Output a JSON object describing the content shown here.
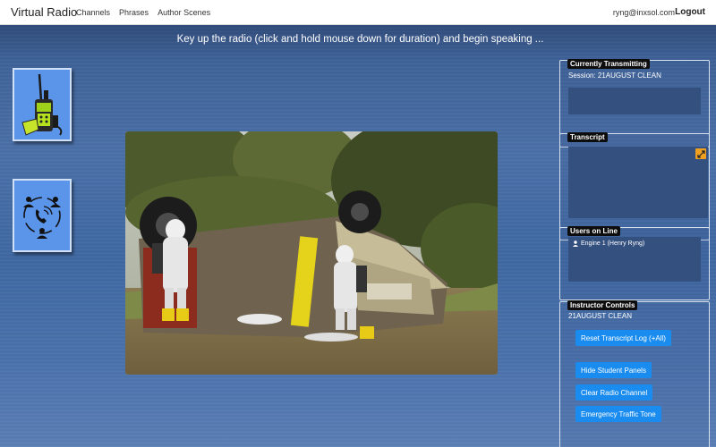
{
  "navbar": {
    "brand": "Virtual Radio",
    "links": [
      "Channels",
      "Phrases",
      "Author Scenes"
    ],
    "user_email": "ryng@inxsol.com",
    "logout": "Logout"
  },
  "instruction": "Key up the radio (click and hold mouse down for duration) and begin speaking ...",
  "left_buttons": {
    "radio_icon": "handheld-radio-icon",
    "call_icon": "conference-call-icon"
  },
  "panels": {
    "currently_transmitting": {
      "title": "Currently Transmitting",
      "session": "Session: 21AUGUST CLEAN"
    },
    "transcript": {
      "title": "Transcript",
      "expand_icon": "expand-icon"
    },
    "users_on_line": {
      "title": "Users on Line",
      "users": [
        "Engine 1 (Henry Ryng)"
      ]
    },
    "instructor_controls": {
      "title": "Instructor Controls",
      "session_name": "21AUGUST CLEAN",
      "buttons": [
        "Reset Transcript Log (+All)",
        "Hide Student Panels",
        "Clear Radio Channel",
        "Emergency Traffic Tone"
      ]
    }
  },
  "colors": {
    "button_blue": "#1a8cf0",
    "side_button": "#5b95ea",
    "expand_orange": "#f0a020",
    "background_blue": "#4a70a8"
  }
}
